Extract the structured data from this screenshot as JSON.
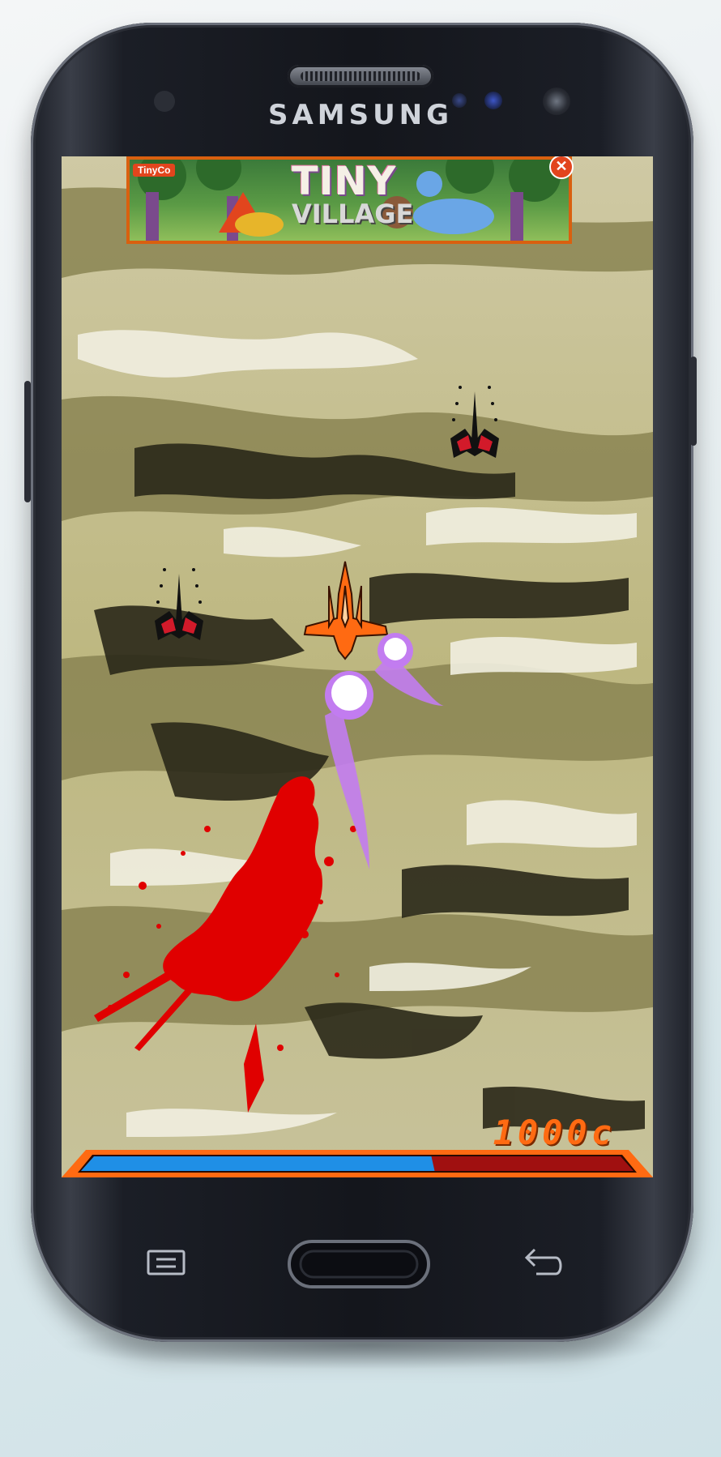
{
  "device": {
    "brand": "SAMSUNG"
  },
  "ad": {
    "brand": "TinyCo",
    "title": "TINY",
    "subtitle": "VILLAGE",
    "close_glyph": "✕"
  },
  "hud": {
    "score": "1000c",
    "health_fraction": 0.64,
    "health_color": "#1f8fe6",
    "damage_color": "#a01010",
    "frame_color": "#ff6a12"
  },
  "enemies": [
    {
      "name": "enemy-ship-1"
    },
    {
      "name": "enemy-ship-2"
    }
  ],
  "player": {
    "name": "player-ship",
    "color": "#ff6a12"
  },
  "projectiles": [
    {
      "name": "plasma-shot-1",
      "color": "#c27cf0"
    },
    {
      "name": "plasma-shot-2",
      "color": "#c27cf0"
    }
  ],
  "effects": {
    "blood_color": "#e00000"
  },
  "nav": {
    "menu_icon": "menu-icon",
    "home_icon": "home-button",
    "back_icon": "back-icon"
  }
}
